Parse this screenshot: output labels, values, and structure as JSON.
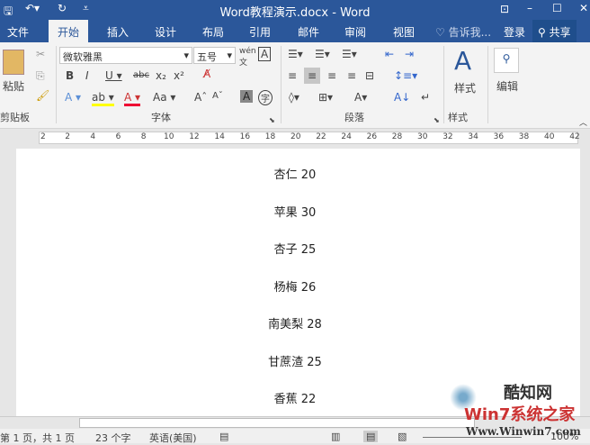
{
  "title": "Word教程演示.docx - Word",
  "tabs": [
    "文件",
    "开始",
    "插入",
    "设计",
    "布局",
    "引用",
    "邮件",
    "审阅",
    "视图"
  ],
  "tell_me": "告诉我...",
  "login": "登录",
  "share": "共享",
  "font_name": "微软雅黑",
  "font_size": "五号",
  "groups": {
    "clipboard": "剪贴板",
    "font": "字体",
    "paragraph": "段落",
    "styles": "样式"
  },
  "paste": "粘贴",
  "styles_btn": "样式",
  "editing_btn": "编辑",
  "ruler": [
    "2",
    "2",
    "4",
    "6",
    "8",
    "10",
    "12",
    "14",
    "16",
    "18",
    "20",
    "22",
    "24",
    "26",
    "28",
    "30",
    "32",
    "34",
    "36",
    "38",
    "40",
    "42"
  ],
  "lines": [
    "杏仁 20",
    "苹果 30",
    "杏子 25",
    "杨梅 26",
    "南美梨 28",
    "甘蔗渣 25",
    "香蕉 22"
  ],
  "status": {
    "page": "第 1 页，共 1 页",
    "words": "23 个字",
    "lang": "英语(美国)",
    "zoom": "100%"
  },
  "watermark": {
    "brand": "酷知网",
    "site": "Win7系统之家",
    "url": "Www.Winwin7.com"
  }
}
